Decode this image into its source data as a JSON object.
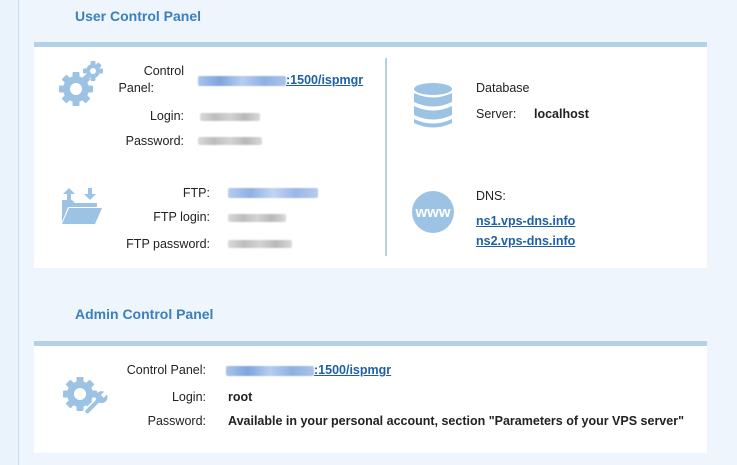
{
  "user_panel": {
    "title": "User Control Panel",
    "control_panel_label_1": "Control",
    "control_panel_label_2": "Panel:",
    "control_panel_link_suffix": ":1500/ispmgr",
    "login_label": "Login:",
    "password_label": "Password:",
    "ftp_label": "FTP:",
    "ftp_login_label": "FTP login:",
    "ftp_password_label": "FTP password:",
    "database_label": "Database",
    "server_label": "Server:",
    "server_value": "localhost",
    "dns_label": "DNS:",
    "dns_1": "ns1.vps-dns.info",
    "dns_2": "ns2.vps-dns.info"
  },
  "admin_panel": {
    "title": "Admin Control Panel",
    "control_panel_label": "Control Panel:",
    "control_panel_link_suffix": ":1500/ispmgr",
    "login_label": "Login:",
    "login_value": "root",
    "password_label": "Password:",
    "password_value": "Available in your personal account, section \"Parameters of your VPS server\""
  },
  "icons": {
    "settings": "gears-icon",
    "ftp": "folder-upload-download-icon",
    "database": "database-icon",
    "dns": "www-globe-icon",
    "admin": "gear-wrench-icon"
  },
  "colors": {
    "accent": "#3b7fbf",
    "link": "#1f5fa8",
    "icon": "#9cc3e4",
    "border": "#b3d2ea"
  }
}
